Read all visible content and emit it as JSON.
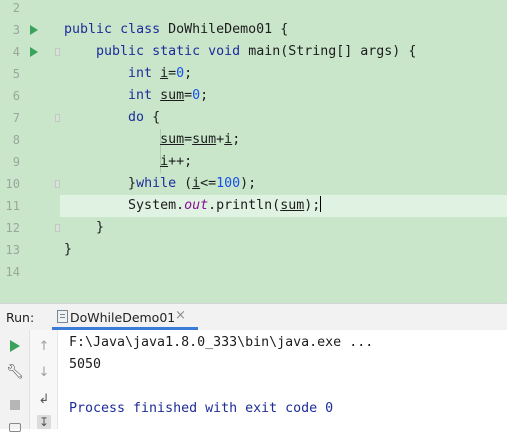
{
  "editor": {
    "line_numbers": [
      "2",
      "3",
      "4",
      "5",
      "6",
      "7",
      "8",
      "9",
      "10",
      "11",
      "12",
      "13",
      "14"
    ],
    "code": {
      "l3": {
        "kw1": "public",
        "kw2": "class",
        "name": "DoWhileDemo01",
        "brace": " {"
      },
      "l4": {
        "kw1": "public",
        "kw2": "static",
        "kw3": "void",
        "method": "main",
        "params": "(String[] args) {"
      },
      "l5": {
        "type": "int",
        "var": "i",
        "eq": "=",
        "val": "0",
        "end": ";"
      },
      "l6": {
        "type": "int",
        "var": "sum",
        "eq": "=",
        "val": "0",
        "end": ";"
      },
      "l7": {
        "kw": "do",
        "brace": " {"
      },
      "l8": {
        "a": "sum",
        "b": "=",
        "c": "sum",
        "d": "+",
        "e": "i",
        "f": ";"
      },
      "l9": {
        "var": "i",
        "op": "++;"
      },
      "l10": {
        "close": "}",
        "kw": "while",
        "open": " (",
        "var": "i",
        "op": "<=",
        "val": "100",
        "end": ");"
      },
      "l11": {
        "obj": "System.",
        "field": "out",
        "call": ".println(",
        "arg": "sum",
        "end": ");"
      },
      "l12": {
        "text": "}"
      },
      "l13": {
        "text": "}"
      }
    }
  },
  "run_panel": {
    "label": "Run:",
    "tab_title": "DoWhileDemo01",
    "tab_close": "×",
    "toolbar_left": [
      "run-again-icon",
      "wrench-icon",
      "stop-icon",
      "camera-icon"
    ],
    "toolbar_right": [
      "up-arrow-icon",
      "down-arrow-icon",
      "soft-wrap-icon",
      "scroll-to-end-icon"
    ],
    "console": {
      "command": "F:\\Java\\java1.8.0_333\\bin\\java.exe ...",
      "output": "5050",
      "exit_message": "Process finished with exit code 0"
    }
  },
  "colors": {
    "editor_bg": "#c9e6cb",
    "keyword": "#1d2d98",
    "number": "#1750eb",
    "field_italic": "#871094",
    "run_green": "#3aa25a",
    "tab_underline": "#3d7cd6"
  }
}
